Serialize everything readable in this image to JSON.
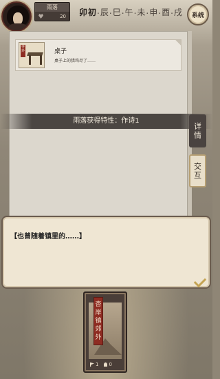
{
  "player": {
    "name": "雨落",
    "hp": "20"
  },
  "time": {
    "hours": [
      "卯",
      "初",
      ".",
      "辰",
      ".",
      "巳",
      ".",
      "午",
      ".",
      "未",
      ".",
      "申",
      ".",
      "酉",
      ".",
      "戌"
    ],
    "system_label": "系统"
  },
  "item": {
    "thumb_tag": "寺外",
    "title": "桌子",
    "desc": "桌子上的猎鸡尽了……"
  },
  "banner": "雨落获得特性：作诗1",
  "tabs": {
    "detail": [
      "详",
      "情"
    ],
    "interact": [
      "交",
      "互"
    ]
  },
  "dialog": {
    "text": "【也曾随着镇里的……】"
  },
  "location": {
    "sign": "杏岸镇郊外",
    "flags": "1",
    "people": "0"
  }
}
